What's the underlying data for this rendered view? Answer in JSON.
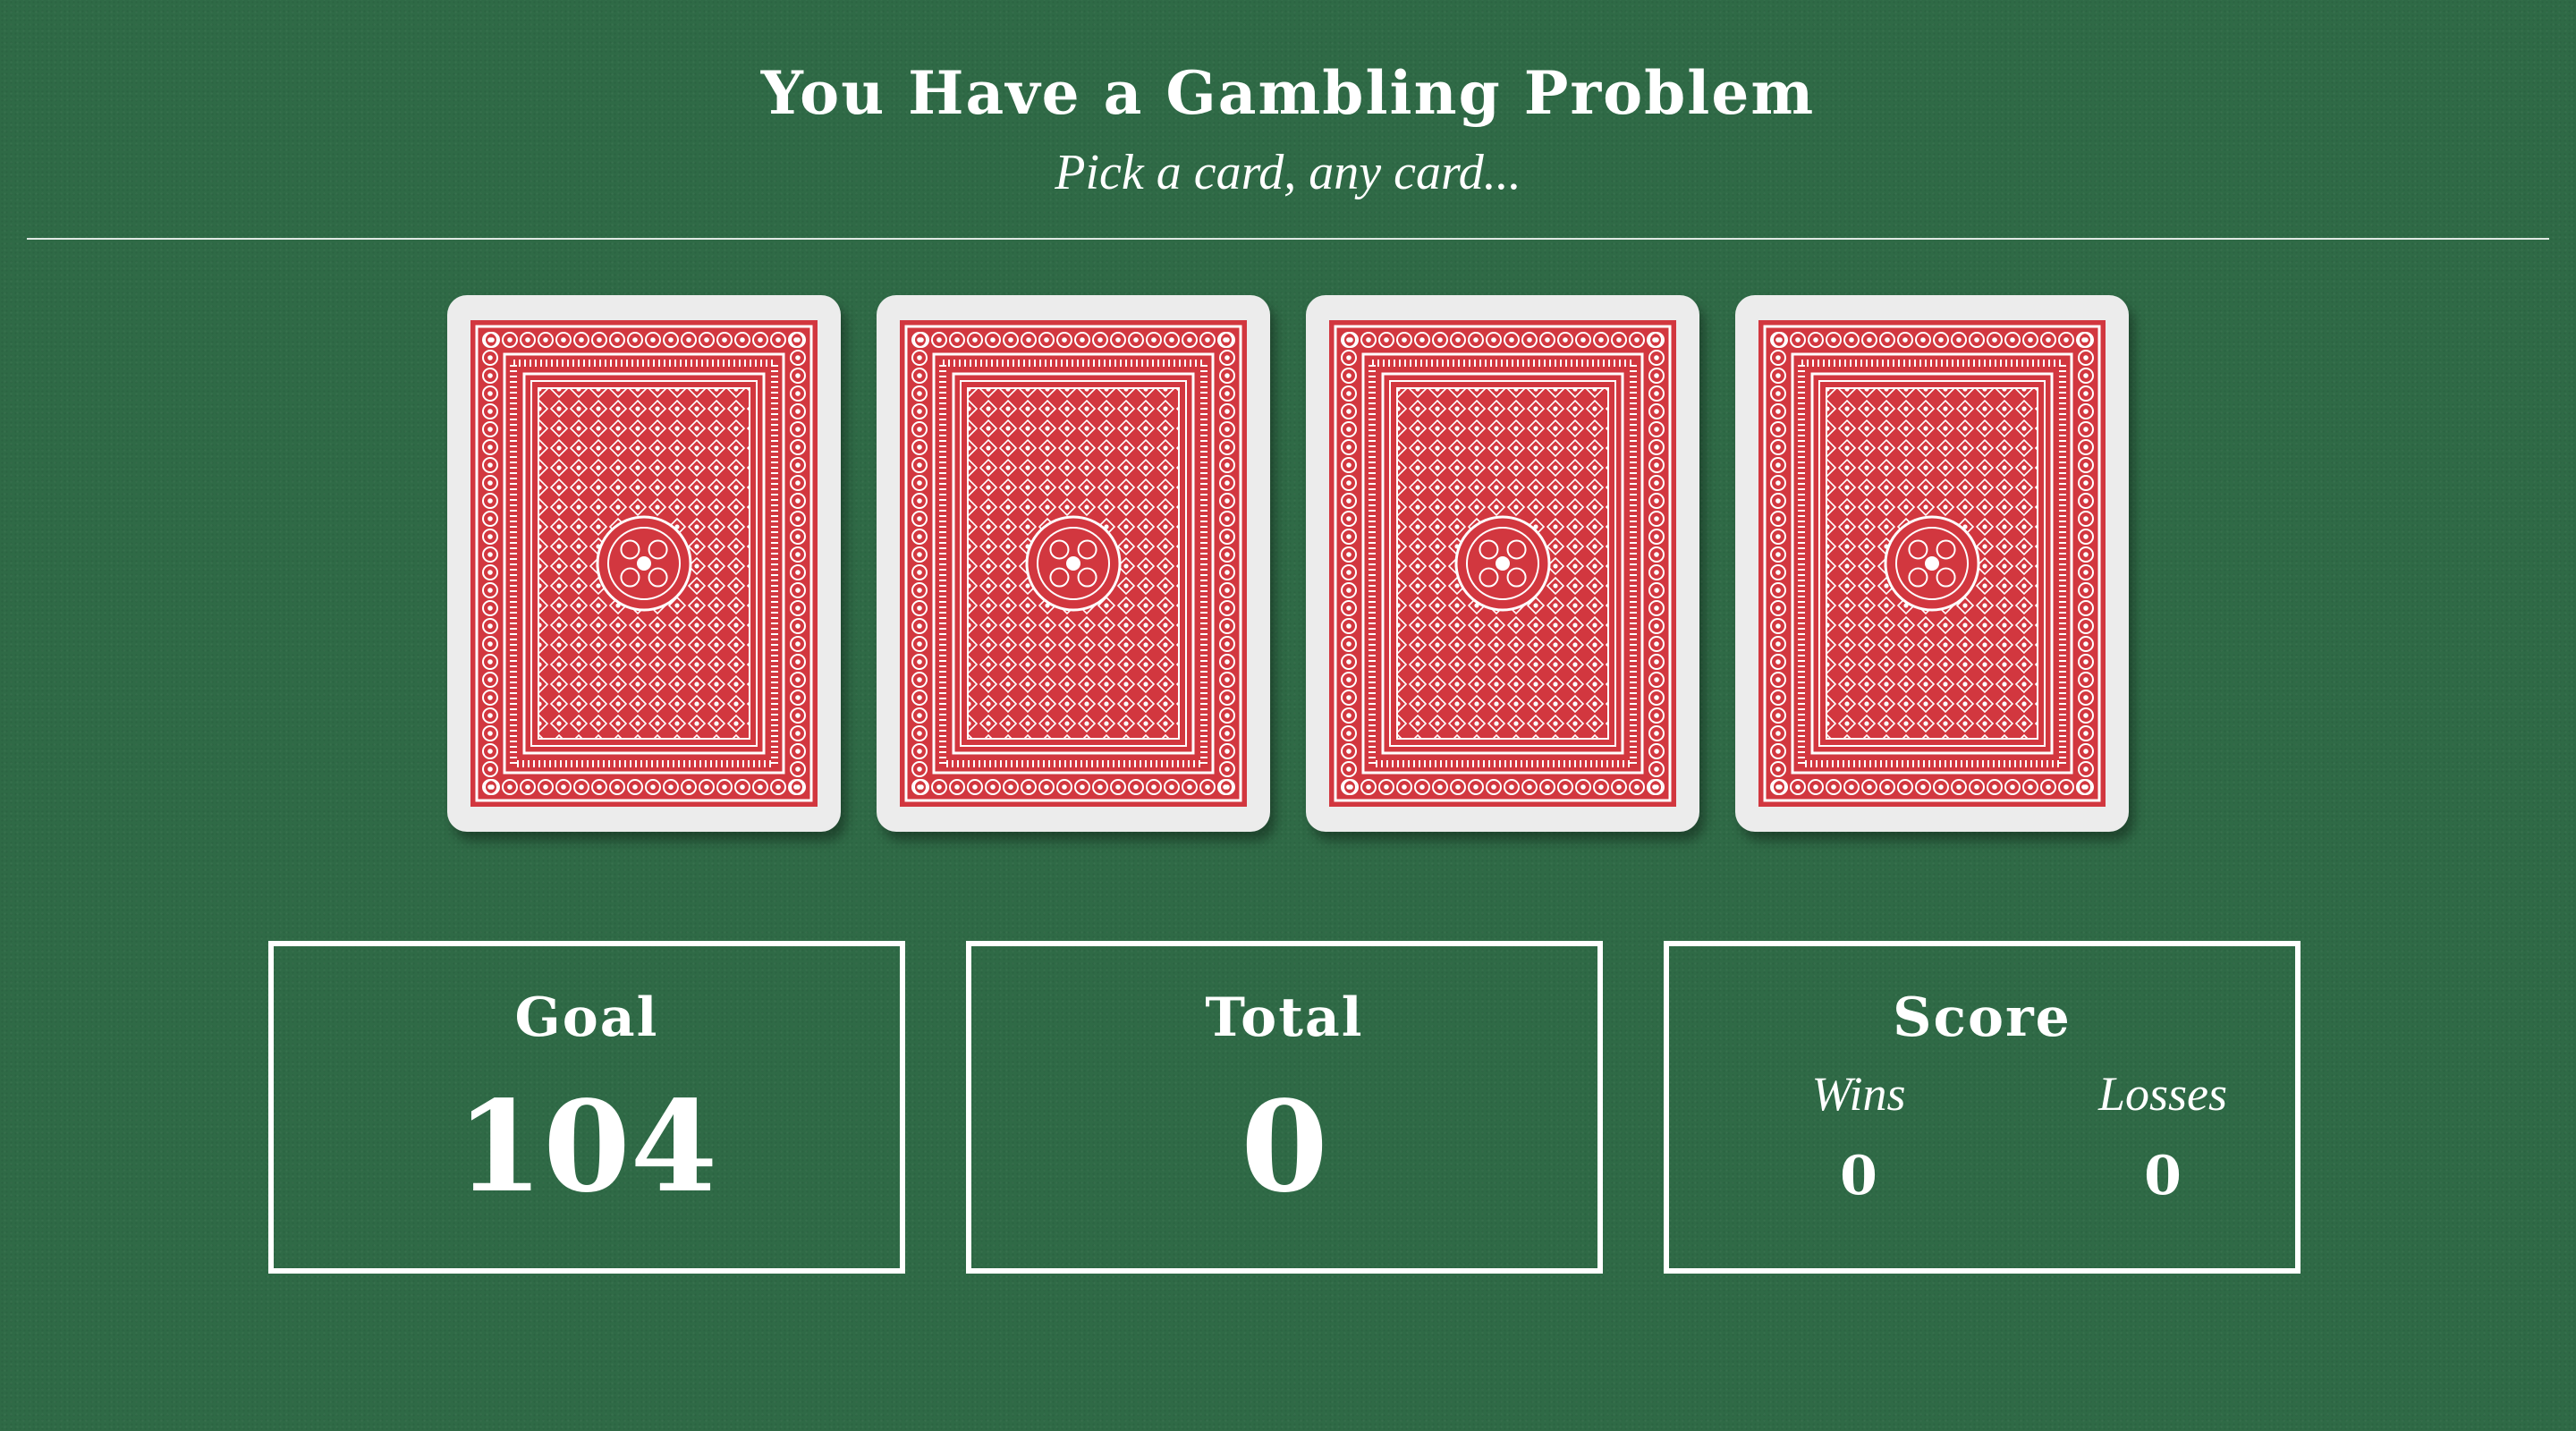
{
  "header": {
    "title": "You Have a Gambling Problem",
    "subtitle": "Pick a card, any card..."
  },
  "cards": [
    {
      "state": "face-down"
    },
    {
      "state": "face-down"
    },
    {
      "state": "face-down"
    },
    {
      "state": "face-down"
    }
  ],
  "stats": {
    "goal": {
      "label": "Goal",
      "value": "104"
    },
    "total": {
      "label": "Total",
      "value": "0"
    },
    "score": {
      "label": "Score",
      "wins_label": "Wins",
      "wins_value": "0",
      "losses_label": "Losses",
      "losses_value": "0"
    }
  },
  "colors": {
    "felt": "#2f6a46",
    "card_back_red": "#d2373f",
    "card_border": "#ececec",
    "text": "#ffffff"
  }
}
